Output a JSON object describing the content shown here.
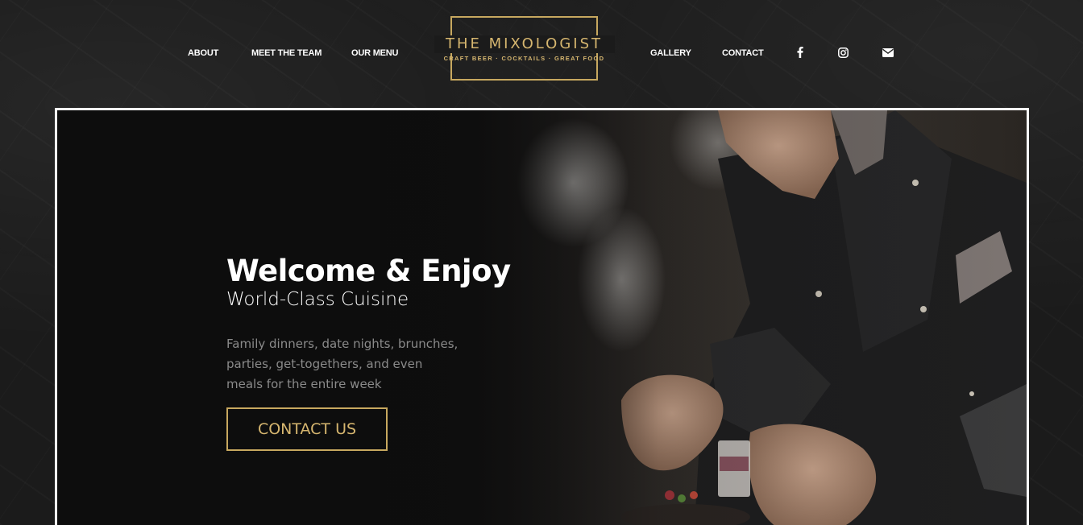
{
  "nav": {
    "left": [
      "ABOUT",
      "MEET THE TEAM",
      "OUR MENU"
    ],
    "right": [
      "GALLERY",
      "CONTACT"
    ]
  },
  "logo": {
    "title": "THE MIXOLOGIST",
    "tagline": "CRAFT BEER · COCKTAILS · GREAT FOOD"
  },
  "social": [
    "facebook-icon",
    "instagram-icon",
    "envelope-icon"
  ],
  "hero": {
    "title": "Welcome & Enjoy",
    "subtitle": "World-Class Cuisine",
    "body": "Family dinners, date nights, brunches, parties, get-togethers, and even meals for the entire week",
    "cta": "CONTACT US"
  },
  "colors": {
    "accent": "#c7a85f",
    "background": "#1b1b1b",
    "text": "#ffffff",
    "muted": "#8a8a8a"
  }
}
